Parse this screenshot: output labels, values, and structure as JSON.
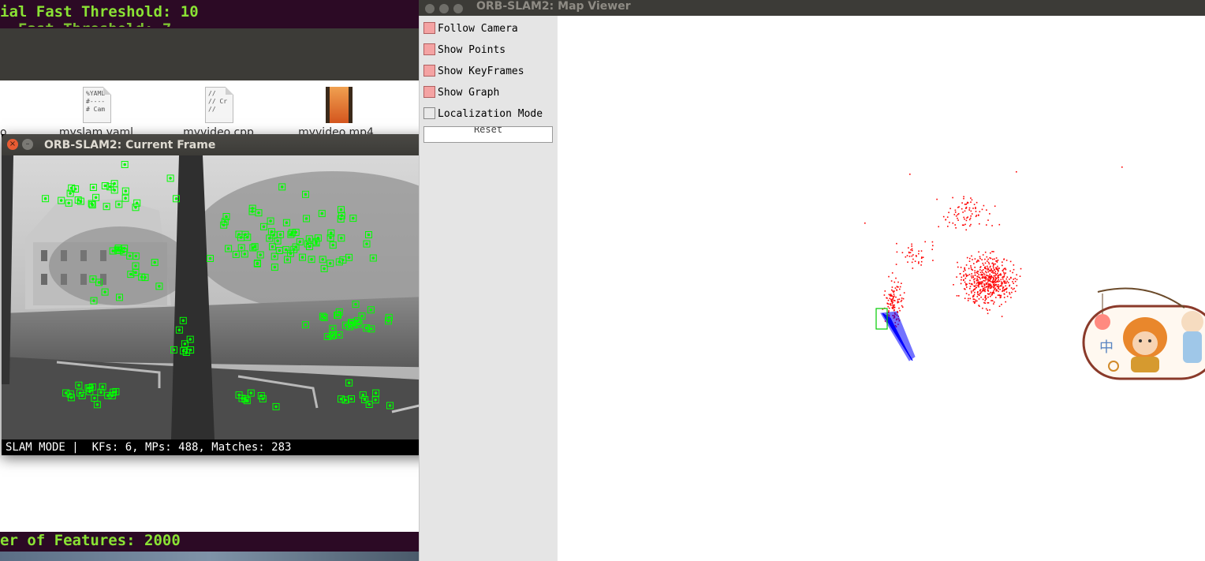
{
  "terminal": {
    "line_top": "ial Fast Threshold: 10",
    "line_partial": "  Fast Threshold: 7",
    "line_bottom": "er of Features: 2000"
  },
  "file_manager": {
    "files": [
      {
        "name": "myslam.yaml",
        "icon": "yaml-file-icon",
        "preview": "%YAML\n#----\n# Cam"
      },
      {
        "name": "myvideo.cpp",
        "icon": "cpp-file-icon",
        "preview": "//\n// Cr\n//"
      },
      {
        "name": "myvideo.mp4",
        "icon": "video-file-icon",
        "preview": ""
      }
    ],
    "partial_left_label": "o"
  },
  "current_frame": {
    "title": "ORB-SLAM2: Current Frame",
    "status": "SLAM MODE |  KFs: 6, MPs: 488, Matches: 283",
    "marker_color": "#00ff00"
  },
  "map_viewer": {
    "title": "ORB-SLAM2: Map Viewer",
    "options": [
      {
        "label": "Follow Camera",
        "checked": true
      },
      {
        "label": "Show Points",
        "checked": true
      },
      {
        "label": "Show KeyFrames",
        "checked": true
      },
      {
        "label": "Show Graph",
        "checked": true
      },
      {
        "label": "Localization Mode",
        "checked": false
      }
    ],
    "reset_label": "Reset",
    "point_color": "#ff0000",
    "keyframe_color": "#0000ff",
    "current_camera_color": "#00cc00"
  },
  "sticker": {
    "badge_char": "中"
  }
}
